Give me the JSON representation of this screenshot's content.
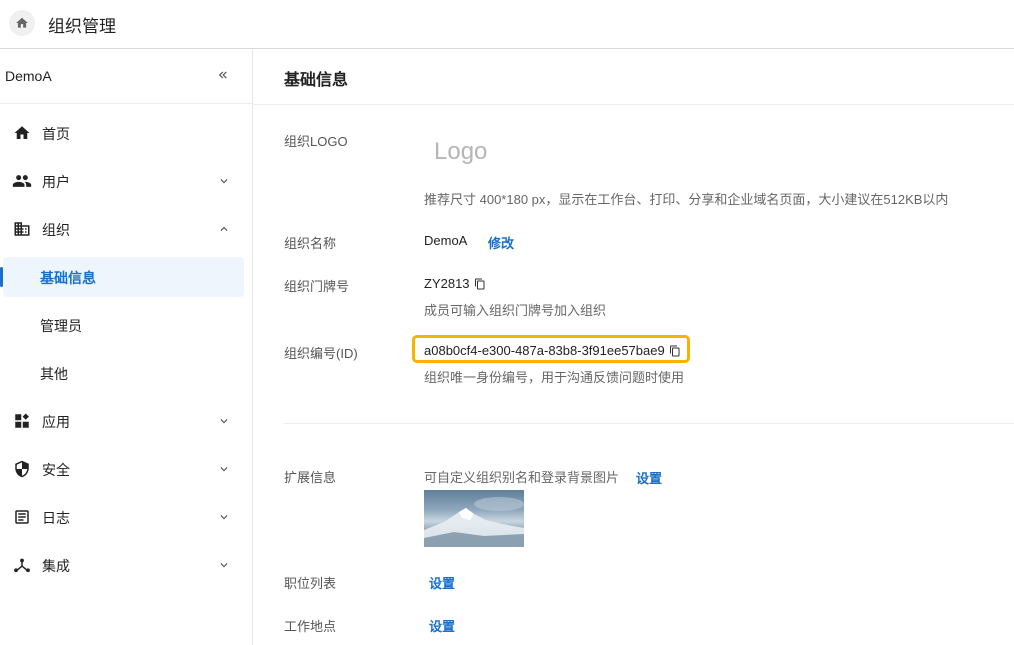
{
  "header": {
    "title": "组织管理",
    "home_icon": "home-icon"
  },
  "sidebar": {
    "org_name": "DemoA",
    "collapse_icon": "double-chevron-left-icon",
    "items": [
      {
        "label": "首页",
        "icon": "home-icon"
      },
      {
        "label": "用户",
        "icon": "users-icon",
        "expanded": false
      },
      {
        "label": "组织",
        "icon": "building-icon",
        "expanded": true
      },
      {
        "label": "应用",
        "icon": "apps-icon",
        "expanded": false
      },
      {
        "label": "安全",
        "icon": "shield-icon",
        "expanded": false
      },
      {
        "label": "日志",
        "icon": "log-icon",
        "expanded": false
      },
      {
        "label": "集成",
        "icon": "integration-icon",
        "expanded": false
      }
    ],
    "sub_items": [
      {
        "label": "基础信息",
        "active": true
      },
      {
        "label": "管理员",
        "active": false
      },
      {
        "label": "其他",
        "active": false
      }
    ]
  },
  "main": {
    "title": "基础信息",
    "logo": {
      "label": "组织LOGO",
      "placeholder": "Logo",
      "hint": "推荐尺寸 400*180 px，显示在工作台、打印、分享和企业域名页面，大小建议在512KB以内"
    },
    "org_name": {
      "label": "组织名称",
      "value": "DemoA",
      "action": "修改"
    },
    "doorplate": {
      "label": "组织门牌号",
      "value": "ZY2813",
      "hint": "成员可输入组织门牌号加入组织"
    },
    "org_id": {
      "label": "组织编号(ID)",
      "value": "a08b0cf4-e300-487a-83b8-3f91ee57bae9",
      "hint": "组织唯一身份编号，用于沟通反馈问题时使用"
    },
    "extension": {
      "label": "扩展信息",
      "hint": "可自定义组织别名和登录背景图片",
      "action": "设置"
    },
    "positions": {
      "label": "职位列表",
      "action": "设置"
    },
    "locations": {
      "label": "工作地点",
      "action": "设置"
    }
  },
  "colors": {
    "accent": "#1a6fc9",
    "highlight_border": "#f4b400",
    "active_bg": "#eef5fc"
  }
}
